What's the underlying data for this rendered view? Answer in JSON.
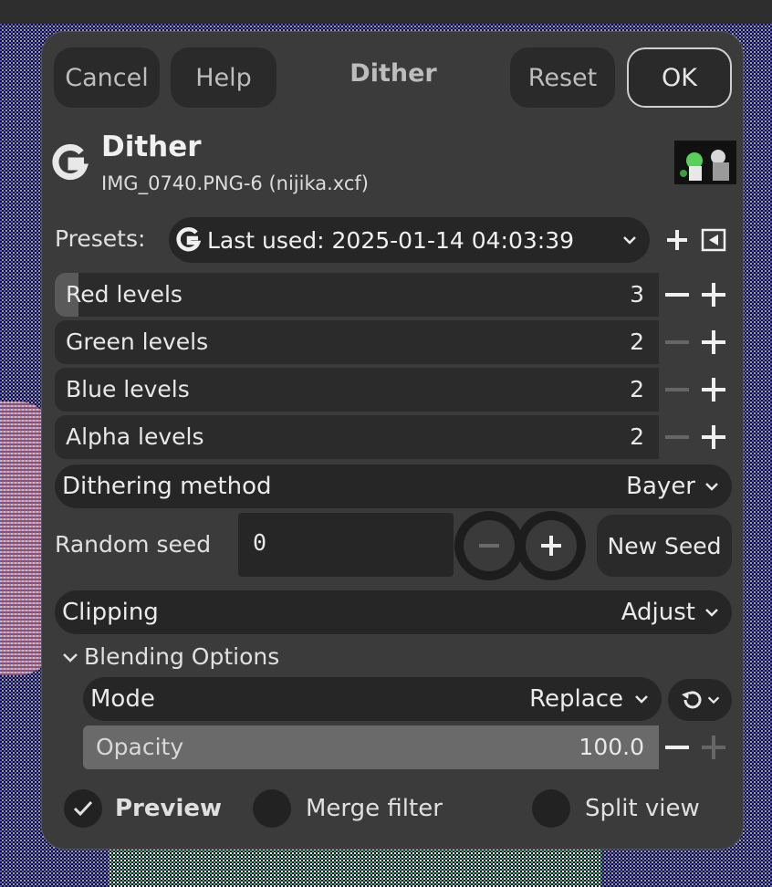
{
  "header": {
    "cancel": "Cancel",
    "help": "Help",
    "title": "Dither",
    "reset": "Reset",
    "ok": "OK"
  },
  "filter": {
    "name": "Dither",
    "image": "IMG_0740.PNG-6 (nijika.xcf)",
    "logo_icon": "gimp-logo-icon"
  },
  "presets": {
    "label": "Presets:",
    "value": "Last used: 2025-01-14 04:03:39",
    "add_icon": "plus-icon",
    "menu_icon": "triangle-menu-icon"
  },
  "levels": [
    {
      "label": "Red levels",
      "value": "3",
      "fraction": 0.04
    },
    {
      "label": "Green levels",
      "value": "2",
      "fraction": 0
    },
    {
      "label": "Blue levels",
      "value": "2",
      "fraction": 0
    },
    {
      "label": "Alpha levels",
      "value": "2",
      "fraction": 0
    }
  ],
  "dithering": {
    "label": "Dithering method",
    "value": "Bayer"
  },
  "seed": {
    "label": "Random seed",
    "value": "0",
    "new_seed": "New Seed"
  },
  "clipping": {
    "label": "Clipping",
    "value": "Adjust"
  },
  "blending": {
    "header": "Blending Options",
    "mode_label": "Mode",
    "mode_value": "Replace",
    "opacity_label": "Opacity",
    "opacity_value": "100.0",
    "opacity_fraction": 1.0
  },
  "footer": {
    "preview": "Preview",
    "preview_checked": true,
    "merge": "Merge filter",
    "split": "Split view"
  },
  "colors": {
    "dialog_bg": "#3b3b3b",
    "field_bg": "#262626",
    "text": "#e6e6e6",
    "disabled": "#777777"
  }
}
